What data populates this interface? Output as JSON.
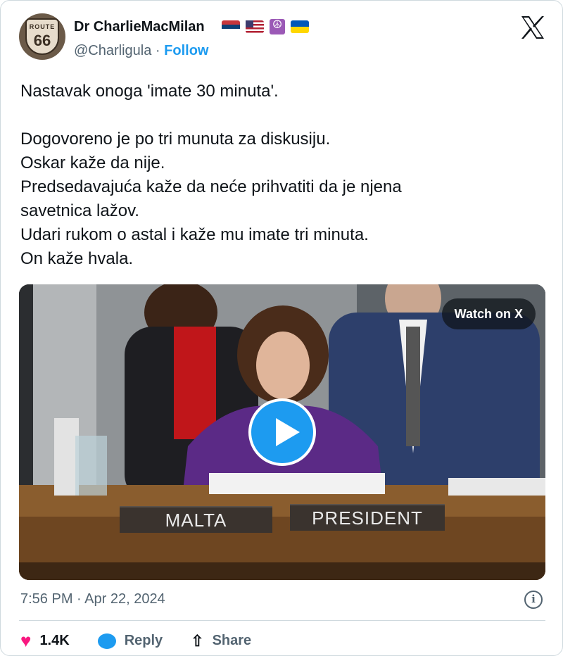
{
  "author": {
    "display_name": "Dr CharlieMacMilan",
    "handle": "@Charligula",
    "separator": "·",
    "follow_label": "Follow",
    "avatar_top_text": "ROUTE",
    "avatar_number": "66",
    "flags": [
      "serbia-flag",
      "us-flag",
      "peace-symbol",
      "ukraine-flag"
    ]
  },
  "platform_logo": "X",
  "tweet": {
    "lines": [
      "Nastavak onoga 'imate 30 minuta'.",
      "",
      "Dogovoreno je po tri munuta za diskusiju.",
      "Oskar kaže da nije.",
      "Predsedavajuća kaže da neće prihvatiti da je njena",
      "savetnica lažov.",
      "Udari rukom o astal i kaže mu imate tri minuta.",
      "On kaže hvala."
    ]
  },
  "video": {
    "watch_label": "Watch on X",
    "placard_left": "MALTA",
    "placard_right": "PRESIDENT"
  },
  "meta": {
    "timestamp": "7:56 PM · Apr 22, 2024",
    "info_icon": "i"
  },
  "actions": {
    "likes": "1.4K",
    "reply_label": "Reply",
    "share_label": "Share"
  },
  "colors": {
    "accent": "#1d9bf0",
    "like": "#f91880",
    "muted": "#536471"
  }
}
